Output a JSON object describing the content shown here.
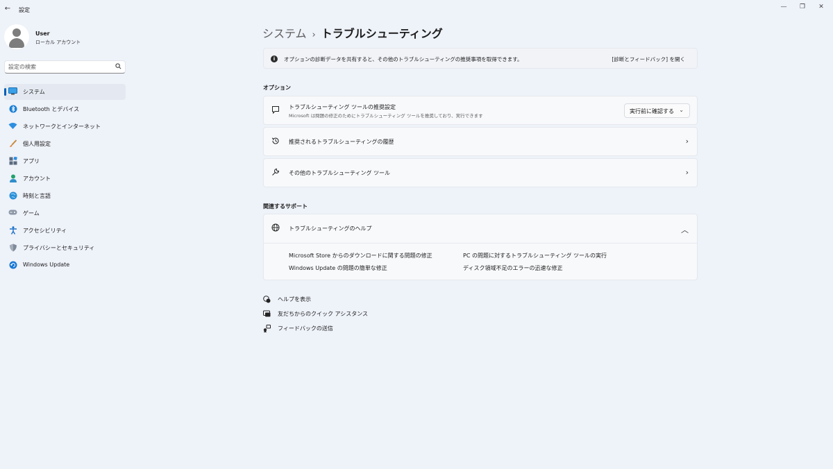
{
  "window": {
    "back_icon": "back-arrow-icon",
    "title": "設定",
    "controls": {
      "minimize": "—",
      "maximize": "❐",
      "close": "✕"
    }
  },
  "profile": {
    "name": "User",
    "account_type": "ローカル アカウント"
  },
  "search": {
    "placeholder": "設定の検索",
    "icon": "search-icon"
  },
  "sidebar": {
    "active_index": 0,
    "items": [
      {
        "label": "システム",
        "icon": "system-icon"
      },
      {
        "label": "Bluetooth とデバイス",
        "icon": "bluetooth-icon"
      },
      {
        "label": "ネットワークとインターネット",
        "icon": "network-icon"
      },
      {
        "label": "個人用設定",
        "icon": "personalization-icon"
      },
      {
        "label": "アプリ",
        "icon": "apps-icon"
      },
      {
        "label": "アカウント",
        "icon": "accounts-icon"
      },
      {
        "label": "時刻と言語",
        "icon": "time-language-icon"
      },
      {
        "label": "ゲーム",
        "icon": "gaming-icon"
      },
      {
        "label": "アクセシビリティ",
        "icon": "accessibility-icon"
      },
      {
        "label": "プライバシーとセキュリティ",
        "icon": "privacy-security-icon"
      },
      {
        "label": "Windows Update",
        "icon": "windows-update-icon"
      }
    ]
  },
  "breadcrumb": {
    "parent": "システム",
    "separator": "›",
    "current": "トラブルシューティング"
  },
  "info_bar": {
    "text": "オプションの診断データを共有すると、その他のトラブルシューティングの推奨事項を取得できます。",
    "link": "[診断とフィードバック] を開く"
  },
  "options": {
    "heading": "オプション",
    "recommended": {
      "title": "トラブルシューティング ツールの推奨設定",
      "subtitle": "Microsoft は問題の修正のためにトラブルシューティング ツールを推奨しており、実行できます",
      "dropdown_value": "実行前に確認する",
      "chevron": "⌄"
    },
    "history": {
      "title": "推奨されるトラブルシューティングの履歴",
      "chevron": "›"
    },
    "other": {
      "title": "その他のトラブルシューティング ツール",
      "chevron": "›"
    }
  },
  "support": {
    "heading": "関連するサポート",
    "help_title": "トラブルシューティングのヘルプ",
    "collapse_chevron": "︿",
    "links": [
      "Microsoft Store からのダウンロードに関する問題の修正",
      "PC の問題に対するトラブルシューティング ツールの実行",
      "Windows Update の問題の簡単な修正",
      "ディスク領域不足のエラーの迅速な修正"
    ]
  },
  "footer_links": [
    {
      "label": "ヘルプを表示",
      "icon": "help-icon"
    },
    {
      "label": "友だちからのクイック アシスタンス",
      "icon": "quick-assist-icon"
    },
    {
      "label": "フィードバックの送信",
      "icon": "feedback-icon"
    }
  ],
  "colors": {
    "background": "#eef2f9",
    "accent": "#005fb8",
    "card": "#f8f9fb"
  }
}
